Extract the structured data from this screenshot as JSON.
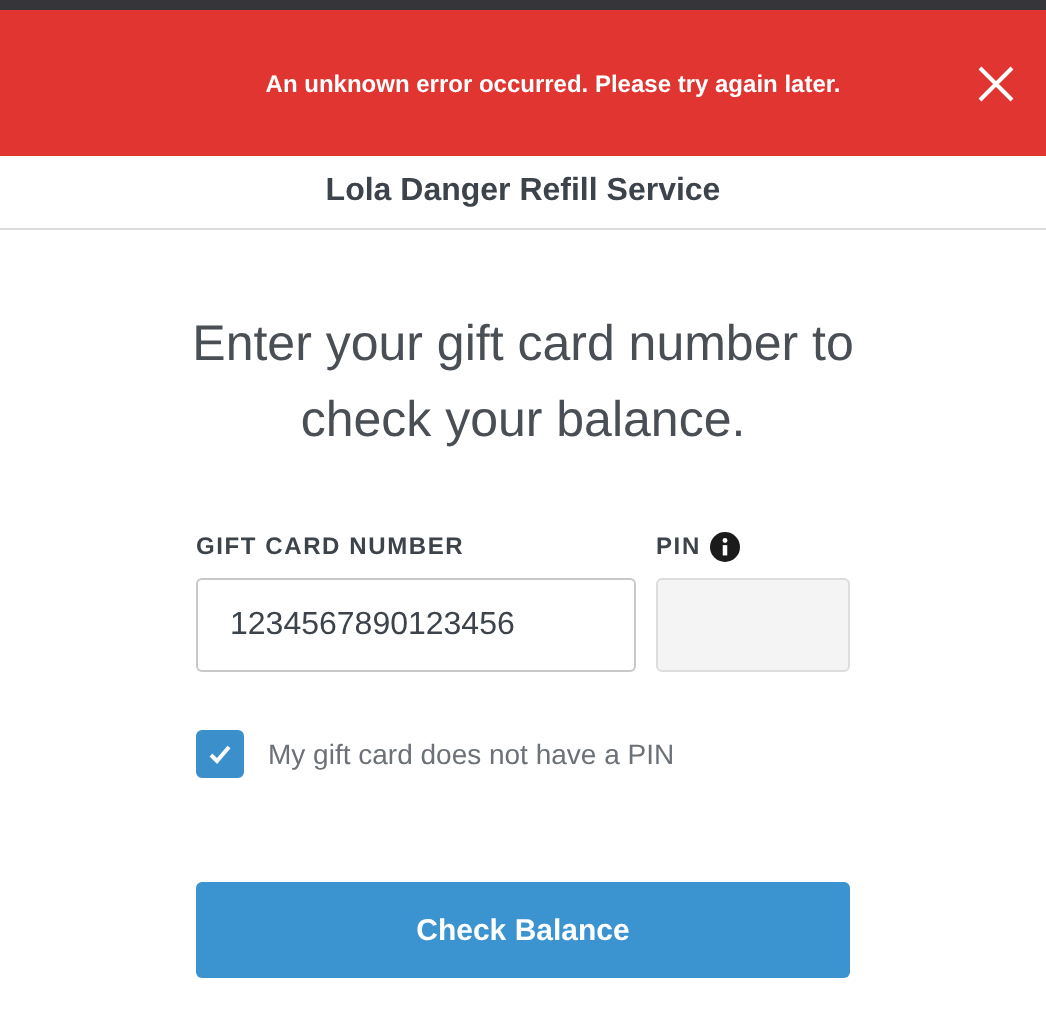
{
  "error_banner": {
    "message": "An unknown error occurred. Please try again later."
  },
  "header": {
    "title": "Lola Danger Refill Service"
  },
  "heading": "Enter your gift card number to check your balance.",
  "card_number_field": {
    "label": "GIFT CARD NUMBER",
    "value": "1234567890123456"
  },
  "pin_field": {
    "label": "PIN",
    "disabled": true
  },
  "no_pin_checkbox": {
    "label": "My gift card does not have a PIN",
    "checked": true
  },
  "submit_button": {
    "label": "Check Balance"
  }
}
